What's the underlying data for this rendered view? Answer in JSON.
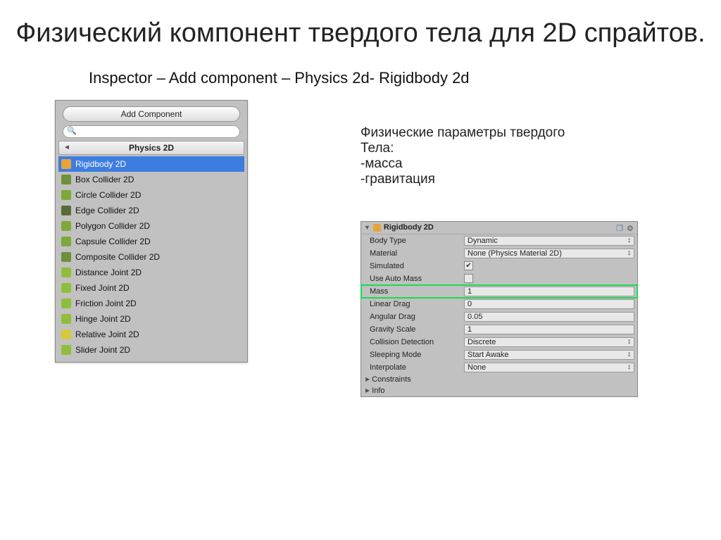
{
  "title": "Физический компонент твердого тела для 2D спрайтов.",
  "subtitle": "Inspector – Add component – Physics 2d- Rigidbody 2d",
  "addComponent": {
    "buttonLabel": "Add Component",
    "searchValue": "",
    "categoryTitle": "Physics 2D",
    "items": [
      {
        "label": "Rigidbody 2D",
        "iconColor": "#e8a33a",
        "selected": true
      },
      {
        "label": "Box Collider 2D",
        "iconColor": "#6f8f3a",
        "selected": false
      },
      {
        "label": "Circle Collider 2D",
        "iconColor": "#7da93a",
        "selected": false
      },
      {
        "label": "Edge Collider 2D",
        "iconColor": "#5a6b3a",
        "selected": false
      },
      {
        "label": "Polygon Collider 2D",
        "iconColor": "#7da93a",
        "selected": false
      },
      {
        "label": "Capsule Collider 2D",
        "iconColor": "#7da93a",
        "selected": false
      },
      {
        "label": "Composite Collider 2D",
        "iconColor": "#6f8f3a",
        "selected": false
      },
      {
        "label": "Distance Joint 2D",
        "iconColor": "#8fbf3a",
        "selected": false
      },
      {
        "label": "Fixed Joint 2D",
        "iconColor": "#8fbf3a",
        "selected": false
      },
      {
        "label": "Friction Joint 2D",
        "iconColor": "#8fbf3a",
        "selected": false
      },
      {
        "label": "Hinge Joint 2D",
        "iconColor": "#8fbf3a",
        "selected": false
      },
      {
        "label": "Relative Joint 2D",
        "iconColor": "#d6c93a",
        "selected": false
      },
      {
        "label": "Slider Joint 2D",
        "iconColor": "#8fbf3a",
        "selected": false
      }
    ]
  },
  "paramsText": {
    "line1": "Физические параметры твердого",
    "line2": "Тела:",
    "line3": "-масса",
    "line4": "-гравитация"
  },
  "inspector": {
    "componentTitle": "Rigidbody 2D",
    "rows": [
      {
        "label": "Body Type",
        "type": "dropdown",
        "value": "Dynamic",
        "highlight": false
      },
      {
        "label": "Material",
        "type": "dropdown",
        "value": "None (Physics Material 2D)",
        "highlight": false
      },
      {
        "label": "Simulated",
        "type": "checkbox",
        "value": "true",
        "highlight": false
      },
      {
        "label": "Use Auto Mass",
        "type": "checkbox",
        "value": "false",
        "highlight": false
      },
      {
        "label": "Mass",
        "type": "number",
        "value": "1",
        "highlight": true
      },
      {
        "label": "Linear Drag",
        "type": "number",
        "value": "0",
        "highlight": false
      },
      {
        "label": "Angular Drag",
        "type": "number",
        "value": "0.05",
        "highlight": false
      },
      {
        "label": "Gravity Scale",
        "type": "number",
        "value": "1",
        "highlight": false
      },
      {
        "label": "Collision Detection",
        "type": "dropdown",
        "value": "Discrete",
        "highlight": false
      },
      {
        "label": "Sleeping Mode",
        "type": "dropdown",
        "value": "Start Awake",
        "highlight": false
      },
      {
        "label": "Interpolate",
        "type": "dropdown",
        "value": "None",
        "highlight": false
      }
    ],
    "foldouts": [
      "Constraints",
      "Info"
    ]
  }
}
